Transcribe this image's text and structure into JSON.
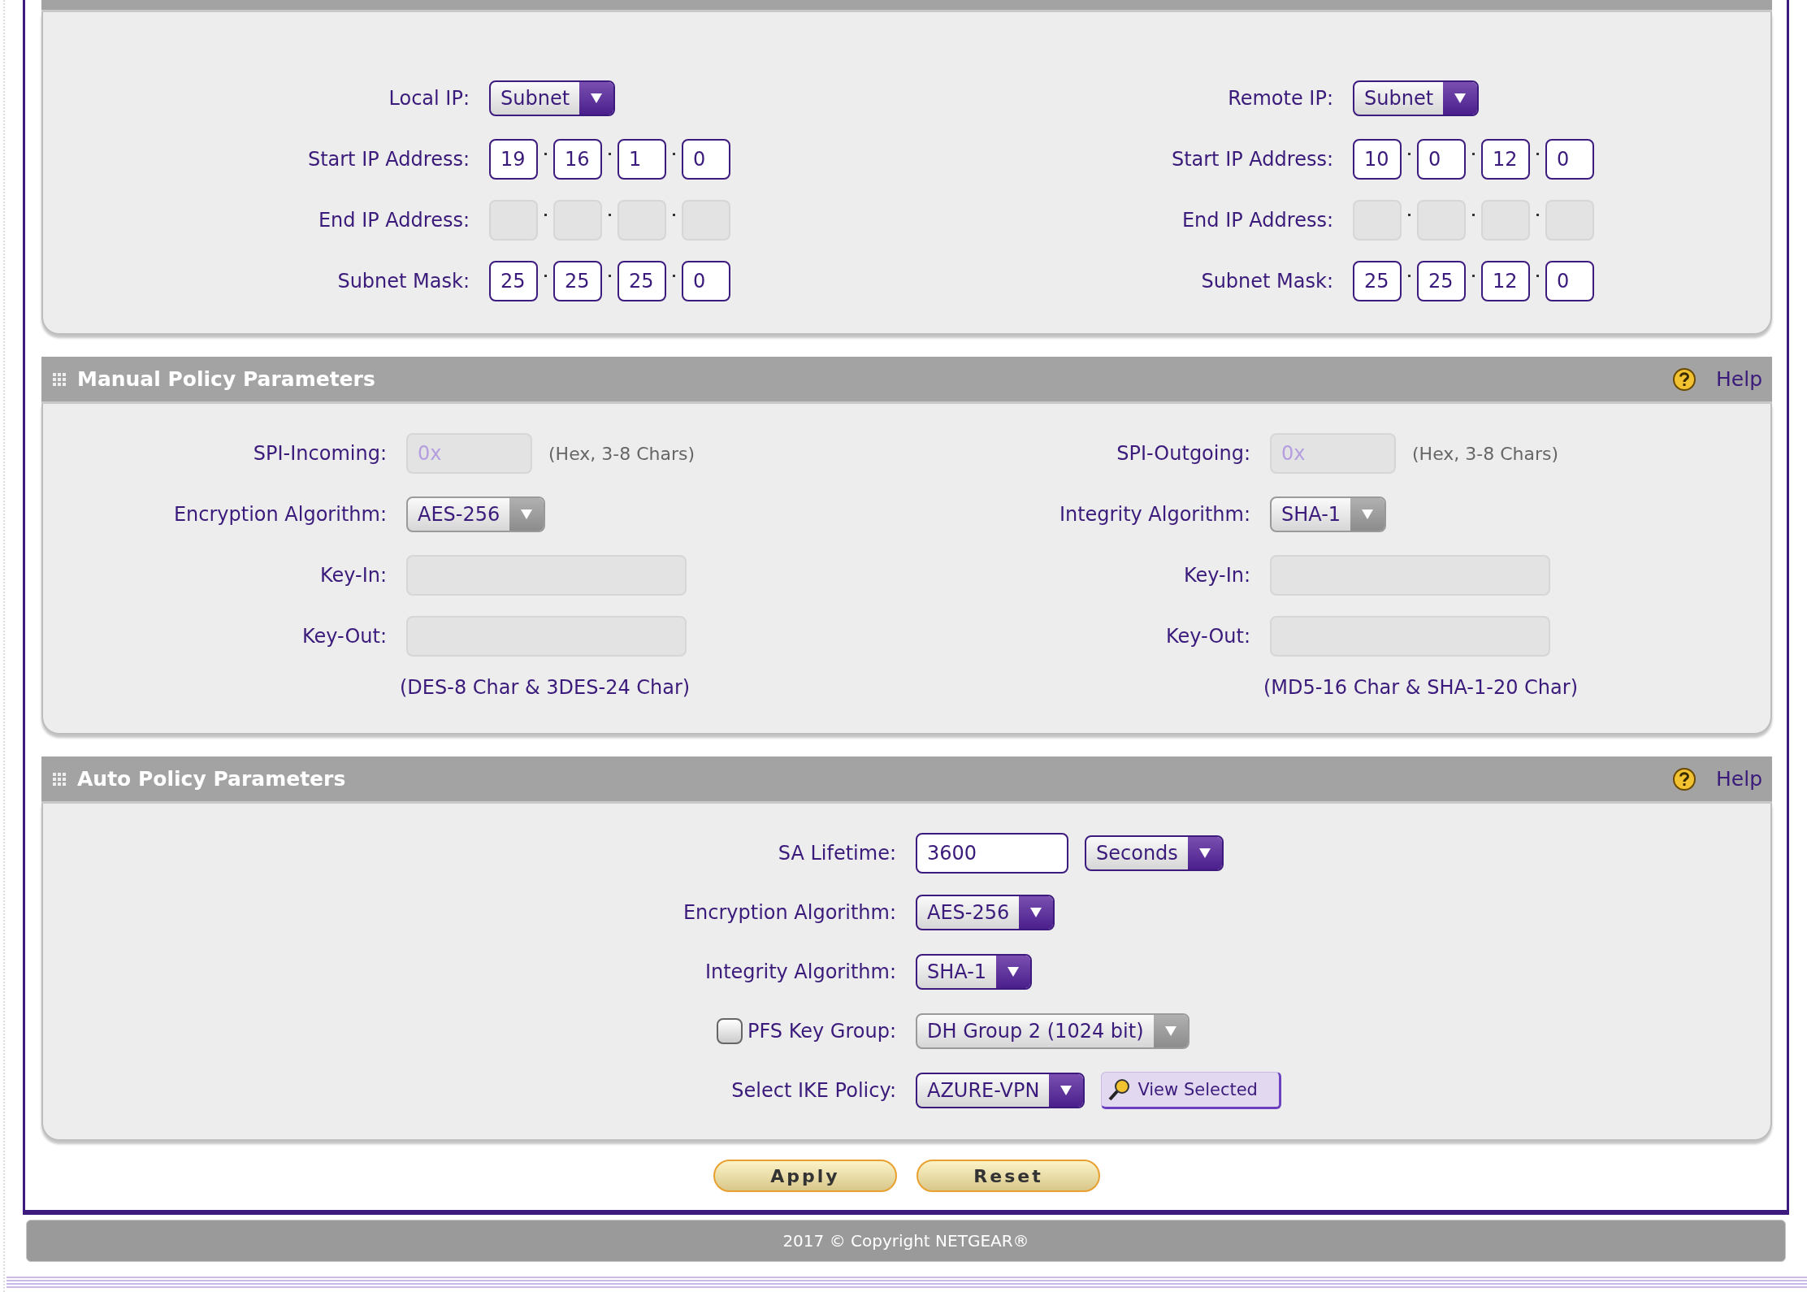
{
  "sections": [
    {
      "kind": "address",
      "columns": [
        {
          "rows": [
            {
              "label": "Local IP:",
              "controls": [
                {
                  "kind": "select",
                  "value": "Subnet",
                  "disabled": false
                }
              ]
            },
            {
              "label": "Start IP Address:",
              "controls": [
                {
                  "kind": "octets",
                  "values": [
                    "19",
                    "16",
                    "1",
                    "0"
                  ],
                  "disabled": false
                }
              ]
            },
            {
              "label": "End IP Address:",
              "controls": [
                {
                  "kind": "octets",
                  "disabled": true
                }
              ]
            },
            {
              "label": "Subnet Mask:",
              "controls": [
                {
                  "kind": "octets",
                  "values": [
                    "25",
                    "25",
                    "25",
                    "0"
                  ],
                  "disabled": false
                }
              ]
            }
          ]
        },
        {
          "rows": [
            {
              "label": "Remote IP:",
              "controls": [
                {
                  "kind": "select",
                  "value": "Subnet",
                  "disabled": false
                }
              ]
            },
            {
              "label": "Start IP Address:",
              "controls": [
                {
                  "kind": "octets",
                  "values": [
                    "10",
                    "0",
                    "12",
                    "0"
                  ],
                  "disabled": false
                }
              ]
            },
            {
              "label": "End IP Address:",
              "controls": [
                {
                  "kind": "octets",
                  "disabled": true
                }
              ]
            },
            {
              "label": "Subnet Mask:",
              "controls": [
                {
                  "kind": "octets",
                  "values": [
                    "25",
                    "25",
                    "12",
                    "0"
                  ],
                  "disabled": false
                }
              ]
            }
          ]
        }
      ]
    },
    {
      "kind": "manual",
      "title": "Manual Policy Parameters",
      "help": "Help",
      "columns": [
        {
          "rows": [
            {
              "label": "SPI-Incoming:",
              "controls": [
                {
                  "kind": "spi",
                  "placeholder": "0x",
                  "disabled": true
                },
                {
                  "kind": "hint",
                  "text": "(Hex, 3-8 Chars)"
                }
              ]
            },
            {
              "label": "Encryption Algorithm:",
              "controls": [
                {
                  "kind": "select",
                  "value": "AES-256",
                  "disabled": true
                }
              ]
            },
            {
              "label": "Key-In:",
              "controls": [
                {
                  "kind": "key",
                  "disabled": true
                }
              ]
            },
            {
              "label": "Key-Out:",
              "controls": [
                {
                  "kind": "key",
                  "disabled": true
                }
              ]
            }
          ],
          "note": "(DES-8 Char & 3DES-24 Char)"
        },
        {
          "rows": [
            {
              "label": "SPI-Outgoing:",
              "controls": [
                {
                  "kind": "spi",
                  "placeholder": "0x",
                  "disabled": true
                },
                {
                  "kind": "hint",
                  "text": "(Hex, 3-8 Chars)"
                }
              ]
            },
            {
              "label": "Integrity Algorithm:",
              "controls": [
                {
                  "kind": "select",
                  "value": "SHA-1",
                  "disabled": true
                }
              ]
            },
            {
              "label": "Key-In:",
              "controls": [
                {
                  "kind": "key",
                  "disabled": true
                }
              ]
            },
            {
              "label": "Key-Out:",
              "controls": [
                {
                  "kind": "key",
                  "disabled": true
                }
              ]
            }
          ],
          "note": "(MD5-16 Char & SHA-1-20 Char)"
        }
      ]
    },
    {
      "kind": "auto",
      "title": "Auto Policy Parameters",
      "help": "Help",
      "columns": [
        {
          "rows": [
            {
              "label": "SA Lifetime:",
              "controls": [
                {
                  "kind": "input",
                  "value": "3600",
                  "disabled": false
                },
                {
                  "kind": "select",
                  "value": "Seconds",
                  "disabled": false
                }
              ]
            },
            {
              "label": "Encryption Algorithm:",
              "controls": [
                {
                  "kind": "select",
                  "value": "AES-256",
                  "disabled": false
                }
              ]
            },
            {
              "label": "Integrity Algorithm:",
              "controls": [
                {
                  "kind": "select",
                  "value": "SHA-1",
                  "disabled": false
                }
              ]
            },
            {
              "label": "PFS Key Group:",
              "checkbox": {
                "checked": false
              },
              "controls": [
                {
                  "kind": "select",
                  "value": "DH Group 2 (1024 bit)",
                  "disabled": true
                }
              ]
            },
            {
              "label": "Select IKE Policy:",
              "controls": [
                {
                  "kind": "select",
                  "value": "AZURE-VPN",
                  "disabled": false
                },
                {
                  "kind": "button",
                  "label": "View Selected"
                }
              ]
            }
          ]
        }
      ]
    }
  ],
  "buttons": [
    {
      "label": "Apply"
    },
    {
      "label": "Reset"
    }
  ],
  "footer": "2017 © Copyright NETGEAR®"
}
